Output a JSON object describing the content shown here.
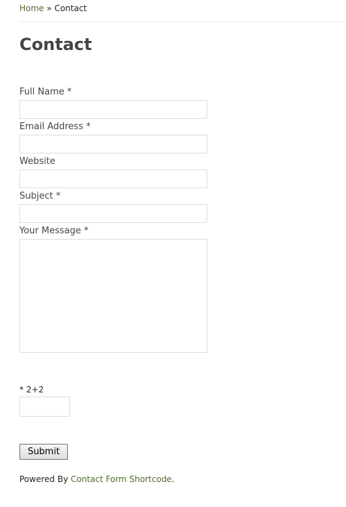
{
  "breadcrumb": {
    "home": "Home",
    "separator": "»",
    "current": "Contact"
  },
  "page": {
    "title": "Contact"
  },
  "form": {
    "full_name_label": "Full Name *",
    "email_label": "Email Address *",
    "website_label": "Website",
    "subject_label": "Subject *",
    "message_label": "Your Message *",
    "captcha_label": "* 2+2",
    "submit_label": "Submit"
  },
  "footer": {
    "powered_prefix": "Powered By",
    "powered_link": "Contact Form Shortcode",
    "powered_suffix": "."
  },
  "colors": {
    "link": "#4e6b2a",
    "text": "#444444",
    "border": "#dddddd"
  }
}
